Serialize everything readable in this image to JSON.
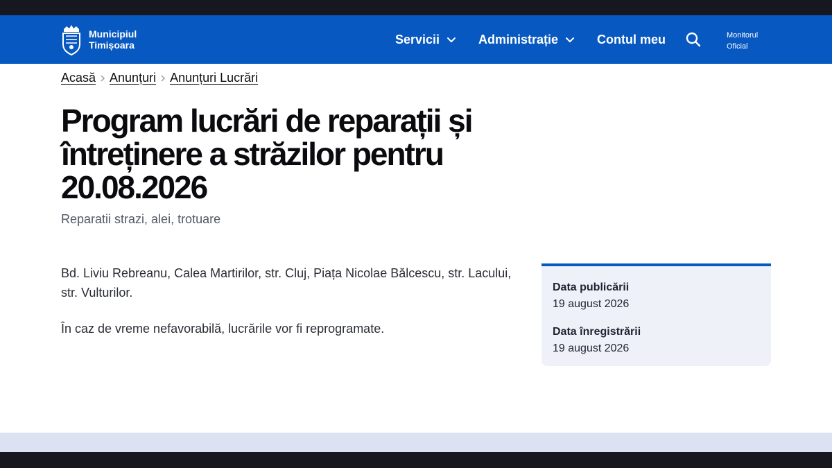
{
  "header": {
    "logo_line1": "Municipiul",
    "logo_line2": "Timișoara",
    "nav": {
      "servicii": "Servicii",
      "administratie": "Administrație",
      "contul_meu": "Contul meu"
    },
    "monitor_line1": "Monitorul",
    "monitor_line2": "Oficial",
    "icons": [
      "crest-icon",
      "chevron-down-icon",
      "search-icon"
    ],
    "colors": {
      "brand": "#0758c0",
      "top_strip": "#16171f"
    }
  },
  "breadcrumb": {
    "items": [
      "Acasă",
      "Anunțuri",
      "Anunțuri Lucrări"
    ],
    "separator_icon": "chevron-right-icon"
  },
  "article": {
    "title": "Program lucrări de reparații și întreținere a străzilor pentru 20.08.2026",
    "subtitle": "Reparatii strazi, alei, trotuare",
    "paragraphs": [
      "Bd. Liviu Rebreanu, Calea Martirilor, str. Cluj, Piața Nicolae Bălcescu, str. Lacului, str. Vulturilor.",
      "În caz de vreme nefavorabilă, lucrările vor fi reprogramate."
    ]
  },
  "meta": {
    "published_label": "Data publicării",
    "published_value": "19 august 2026",
    "registered_label": "Data înregistrării",
    "registered_value": "19 august 2026"
  }
}
